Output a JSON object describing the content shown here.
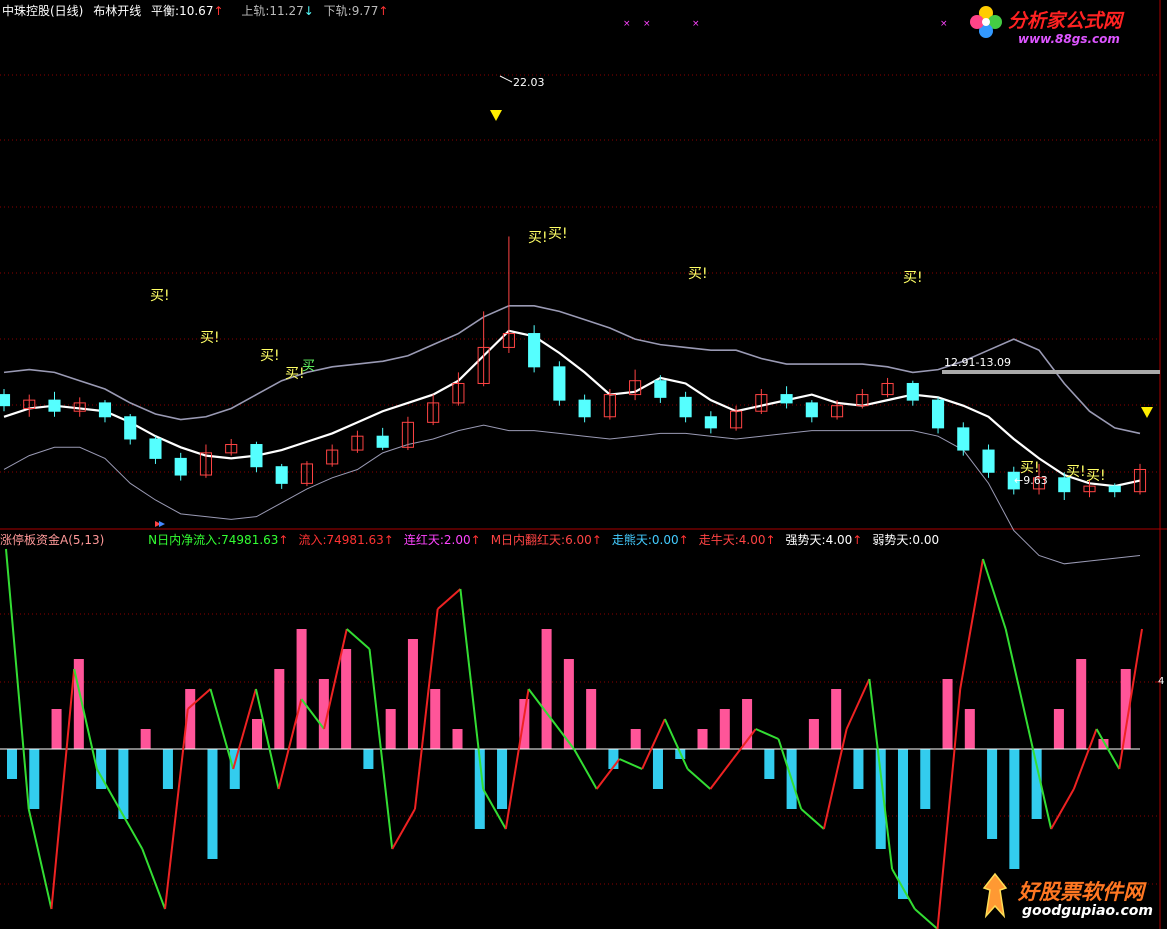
{
  "upper_header": {
    "stock_name": "中珠控股(日线)",
    "indicator": "布林开线",
    "balance_label": "平衡:",
    "balance_value": "10.67",
    "upper_label": "上轨:",
    "upper_value": "11.27",
    "lower_label": "下轨:",
    "lower_value": "9.77"
  },
  "lower_header": {
    "indicator": "涨停板资金A(5,13)",
    "items": [
      {
        "label": "N日内净流入:",
        "value": "74981.63",
        "color": "#33ff33"
      },
      {
        "label": "流入:",
        "value": "74981.63",
        "color": "#ff3333"
      },
      {
        "label": "连红天:",
        "value": "2.00",
        "color": "#ff44ff"
      },
      {
        "label": "M日内翻红天:",
        "value": "6.00",
        "color": "#ff4444"
      },
      {
        "label": "走熊天:",
        "value": "0.00",
        "color": "#44ccff"
      },
      {
        "label": "走牛天:",
        "value": "4.00",
        "color": "#ff4444"
      },
      {
        "label": "强势天:",
        "value": "4.00",
        "color": "#ffffff"
      },
      {
        "label": "弱势天:",
        "value": "0.00",
        "color": "#ffffff"
      }
    ]
  },
  "annotations": {
    "peak_price": "22.03",
    "low_price": "9.63",
    "range_label": "12.91-13.09",
    "buy_label": "买!",
    "buy_label_plain": "买",
    "right_axis_tick": "4"
  },
  "watermarks": {
    "top_brand": "分析家公式网",
    "top_url": "www.88gs.com",
    "bottom_brand": "好股票软件网",
    "bottom_url": "goodgupiao.com"
  },
  "colors": {
    "up": "#ff4444",
    "down": "#55ffff",
    "mid_band": "#ffffff",
    "outer_band": "#9a9ab4",
    "hist_pos": "#ff5599",
    "hist_neg": "#33ccee",
    "line_pos": "#ee2222",
    "line_neg": "#33dd33",
    "zero_line": "#ffffff",
    "label": "#ffff66",
    "grid": "#8b0000"
  },
  "chart_data": [
    {
      "type": "candlestick",
      "title": "中珠控股(日线) 布林开线",
      "ylim": [
        8.0,
        23.5
      ],
      "series": [
        {
          "name": "上轨",
          "values": [
            12.6,
            12.7,
            12.6,
            12.3,
            12.0,
            11.5,
            11.1,
            10.9,
            11.0,
            11.3,
            11.8,
            12.3,
            12.6,
            12.8,
            12.9,
            13.0,
            13.2,
            13.6,
            14.0,
            14.6,
            15.0,
            15.0,
            14.8,
            14.5,
            14.2,
            13.8,
            13.6,
            13.5,
            13.4,
            13.4,
            13.1,
            12.9,
            12.9,
            12.9,
            12.9,
            12.8,
            12.6,
            12.7,
            13.0,
            13.4,
            13.8,
            13.4,
            12.2,
            11.2,
            10.6,
            10.4
          ]
        },
        {
          "name": "平衡",
          "values": [
            11.0,
            11.3,
            11.4,
            11.3,
            11.2,
            10.8,
            10.3,
            9.9,
            9.6,
            9.5,
            9.6,
            9.8,
            10.1,
            10.4,
            10.8,
            11.2,
            11.5,
            11.8,
            12.3,
            13.2,
            14.1,
            13.9,
            13.3,
            12.6,
            11.8,
            11.9,
            12.4,
            12.2,
            11.6,
            11.2,
            11.4,
            11.6,
            11.8,
            11.5,
            11.4,
            11.6,
            11.8,
            11.7,
            11.4,
            11.0,
            10.2,
            9.5,
            8.9,
            8.6,
            8.5,
            8.7
          ]
        },
        {
          "name": "下轨",
          "values": [
            9.1,
            9.6,
            9.9,
            9.9,
            9.5,
            8.6,
            8.0,
            7.5,
            7.4,
            7.3,
            7.4,
            7.9,
            8.4,
            8.8,
            9.1,
            9.7,
            10.0,
            10.2,
            10.5,
            10.7,
            10.5,
            10.5,
            10.4,
            10.3,
            10.2,
            10.3,
            10.4,
            10.4,
            10.3,
            10.2,
            10.3,
            10.4,
            10.5,
            10.5,
            10.5,
            10.5,
            10.5,
            10.3,
            9.8,
            8.6,
            6.9,
            6.0,
            5.7,
            5.8,
            5.9,
            6.0
          ]
        }
      ],
      "candles": [
        [
          11.8,
          11.4,
          12.0,
          11.2
        ],
        [
          11.3,
          11.6,
          11.8,
          11.0
        ],
        [
          11.6,
          11.2,
          11.9,
          11.0
        ],
        [
          11.2,
          11.5,
          11.7,
          11.0
        ],
        [
          11.5,
          11.0,
          11.6,
          10.8
        ],
        [
          11.0,
          10.2,
          11.1,
          10.0
        ],
        [
          10.2,
          9.5,
          10.3,
          9.3
        ],
        [
          9.5,
          8.9,
          9.7,
          8.7
        ],
        [
          8.9,
          9.7,
          10.0,
          8.8
        ],
        [
          9.7,
          10.0,
          10.2,
          9.6
        ],
        [
          10.0,
          9.2,
          10.1,
          9.0
        ],
        [
          9.2,
          8.6,
          9.3,
          8.4
        ],
        [
          8.6,
          9.3,
          9.4,
          8.5
        ],
        [
          9.3,
          9.8,
          10.0,
          9.2
        ],
        [
          9.8,
          10.3,
          10.5,
          9.7
        ],
        [
          10.3,
          9.9,
          10.6,
          9.8
        ],
        [
          9.9,
          10.8,
          11.0,
          9.8
        ],
        [
          10.8,
          11.5,
          11.8,
          10.7
        ],
        [
          11.5,
          12.2,
          12.6,
          11.4
        ],
        [
          12.2,
          13.5,
          14.8,
          12.1
        ],
        [
          13.5,
          14.0,
          17.5,
          13.3
        ],
        [
          14.0,
          12.8,
          14.3,
          12.6
        ],
        [
          12.8,
          11.6,
          13.0,
          11.4
        ],
        [
          11.6,
          11.0,
          11.8,
          10.8
        ],
        [
          11.0,
          11.8,
          12.0,
          10.9
        ],
        [
          11.8,
          12.3,
          12.7,
          11.6
        ],
        [
          12.3,
          11.7,
          12.5,
          11.5
        ],
        [
          11.7,
          11.0,
          11.9,
          10.8
        ],
        [
          11.0,
          10.6,
          11.2,
          10.4
        ],
        [
          10.6,
          11.2,
          11.4,
          10.5
        ],
        [
          11.2,
          11.8,
          12.0,
          11.1
        ],
        [
          11.8,
          11.5,
          12.1,
          11.3
        ],
        [
          11.5,
          11.0,
          11.6,
          10.8
        ],
        [
          11.0,
          11.4,
          11.6,
          10.9
        ],
        [
          11.4,
          11.8,
          12.0,
          11.3
        ],
        [
          11.8,
          12.2,
          12.4,
          11.7
        ],
        [
          12.2,
          11.6,
          12.3,
          11.4
        ],
        [
          11.6,
          10.6,
          11.7,
          10.4
        ],
        [
          10.6,
          9.8,
          10.8,
          9.6
        ],
        [
          9.8,
          9.0,
          10.0,
          8.8
        ],
        [
          9.0,
          8.4,
          9.2,
          8.2
        ],
        [
          8.4,
          8.8,
          9.3,
          8.2
        ],
        [
          8.8,
          8.3,
          9.0,
          8.0
        ],
        [
          8.3,
          8.5,
          8.7,
          8.1
        ],
        [
          8.5,
          8.3,
          8.6,
          8.1
        ],
        [
          8.3,
          9.1,
          9.3,
          8.2
        ]
      ]
    },
    {
      "type": "bar",
      "title": "涨停板资金A(5,13)",
      "ylim": [
        -1.0,
        1.0
      ],
      "values": [
        -0.15,
        -0.3,
        0.2,
        0.45,
        -0.2,
        -0.35,
        0.1,
        -0.2,
        0.3,
        -0.55,
        -0.2,
        0.15,
        0.4,
        0.6,
        0.35,
        0.5,
        -0.1,
        0.2,
        0.55,
        0.3,
        0.1,
        -0.4,
        -0.3,
        0.25,
        0.6,
        0.45,
        0.3,
        -0.1,
        0.1,
        -0.2,
        -0.05,
        0.1,
        0.2,
        0.25,
        -0.15,
        -0.3,
        0.15,
        0.3,
        -0.2,
        -0.5,
        -0.75,
        -0.3,
        0.35,
        0.2,
        -0.45,
        -0.6,
        -0.35,
        0.2,
        0.45,
        0.05,
        0.4
      ],
      "series": [
        {
          "name": "N日内净流入",
          "values": [
            1.0,
            -0.3,
            -0.8,
            0.4,
            -0.1,
            -0.3,
            -0.5,
            -0.8,
            0.2,
            0.3,
            -0.1,
            0.3,
            -0.2,
            0.25,
            0.1,
            0.6,
            0.5,
            -0.5,
            -0.3,
            0.7,
            0.8,
            -0.2,
            -0.4,
            0.3,
            0.15,
            0.0,
            -0.2,
            -0.05,
            -0.1,
            0.15,
            -0.1,
            -0.2,
            -0.05,
            0.1,
            0.05,
            -0.3,
            -0.4,
            0.1,
            0.35,
            -0.6,
            -0.8,
            -0.9,
            0.3,
            0.95,
            0.6,
            0.1,
            -0.4,
            -0.2,
            0.1,
            -0.1,
            0.6
          ]
        }
      ]
    }
  ]
}
